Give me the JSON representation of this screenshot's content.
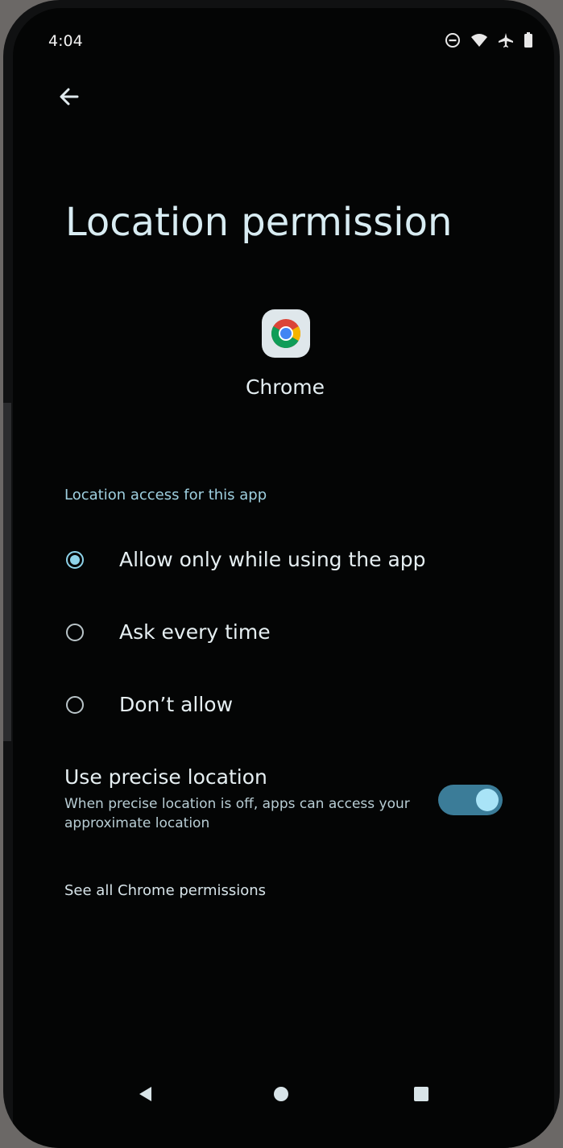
{
  "status_bar": {
    "time": "4:04",
    "icons": [
      "do-not-disturb-icon",
      "wifi-icon",
      "airplane-icon",
      "battery-icon"
    ]
  },
  "header": {
    "back_icon": "back-arrow-icon"
  },
  "page": {
    "title": "Location permission",
    "app_icon": "chrome-icon",
    "app_name": "Chrome"
  },
  "location_access": {
    "section_label": "Location access for this app",
    "options": [
      {
        "label": "Allow only while using the app",
        "checked": true
      },
      {
        "label": "Ask every time",
        "checked": false
      },
      {
        "label": "Don’t allow",
        "checked": false
      }
    ]
  },
  "precise_location": {
    "title": "Use precise location",
    "description": "When precise location is off, apps can access your approximate location",
    "enabled": true
  },
  "links": {
    "see_all": "See all Chrome permissions"
  },
  "nav_bar": {
    "back": "back-triangle-icon",
    "home": "home-circle-icon",
    "recents": "recents-square-icon"
  },
  "colors": {
    "accent": "#8ed3ea",
    "switch_track": "#3b7c98",
    "background": "#040505"
  }
}
